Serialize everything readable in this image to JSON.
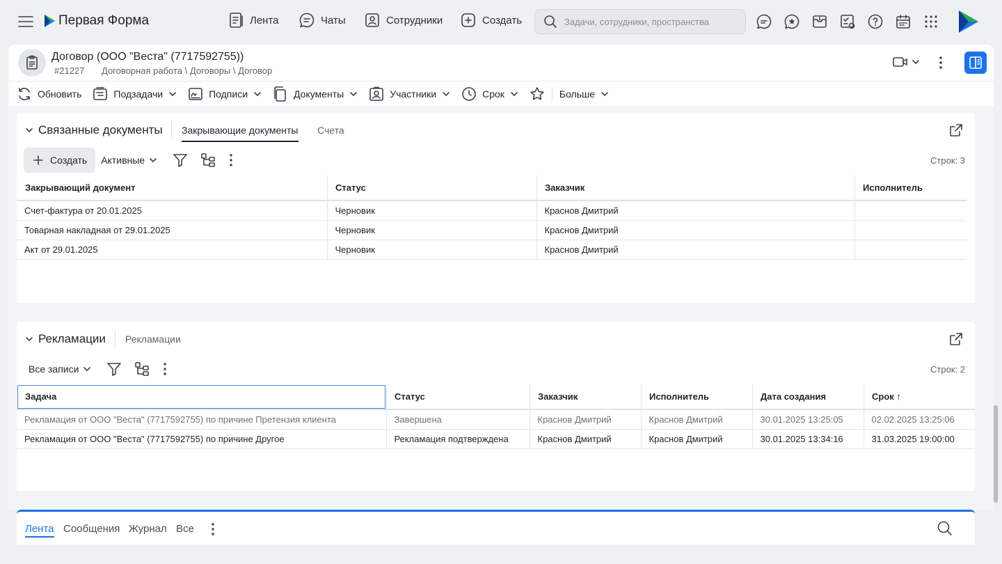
{
  "app": {
    "name": "Первая Форма",
    "nav": [
      {
        "label": "Лента",
        "icon": "feed-icon"
      },
      {
        "label": "Чаты",
        "icon": "chat-icon"
      },
      {
        "label": "Сотрудники",
        "icon": "employees-icon"
      },
      {
        "label": "Создать",
        "icon": "plus-square-icon"
      }
    ],
    "search_placeholder": "Задачи, сотрудники, пространства",
    "brand_color": "#1a73e8"
  },
  "document": {
    "title": "Договор (ООО \"Веста\" (7717592755))",
    "id": "#21227",
    "path": "Договорная работа \\ Договоры \\ Договор"
  },
  "toolbar": [
    {
      "label": "Обновить",
      "icon": "refresh-icon",
      "dropdown": false
    },
    {
      "label": "Подзадачи",
      "icon": "subtasks-icon",
      "dropdown": true
    },
    {
      "label": "Подписи",
      "icon": "signature-icon",
      "dropdown": true
    },
    {
      "label": "Документы",
      "icon": "documents-icon",
      "dropdown": true
    },
    {
      "label": "Участники",
      "icon": "participants-icon",
      "dropdown": true
    },
    {
      "label": "Срок",
      "icon": "clock-icon",
      "dropdown": true
    },
    {
      "label": "",
      "icon": "star-icon",
      "dropdown": false
    },
    {
      "label": "Больше",
      "icon": "",
      "dropdown": true
    }
  ],
  "related_docs": {
    "title": "Связанные документы",
    "tabs": [
      "Закрывающие документы",
      "Счета"
    ],
    "create_label": "Создать",
    "filter_label": "Активные",
    "row_count": "Строк: 3",
    "columns": [
      "Закрывающий документ",
      "Статус",
      "Заказчик",
      "Исполнитель"
    ],
    "rows": [
      [
        "Счет-фактура от 20.01.2025",
        "Черновик",
        "Краснов Дмитрий",
        ""
      ],
      [
        "Товарная накладная от 29.01.2025",
        "Черновик",
        "Краснов Дмитрий",
        ""
      ],
      [
        "Акт от 29.01.2025",
        "Черновик",
        "Краснов Дмитрий",
        ""
      ]
    ]
  },
  "claims": {
    "title": "Рекламации",
    "tabs": [
      "Рекламации"
    ],
    "filter_label": "Все записи",
    "row_count": "Строк: 2",
    "columns": [
      "Задача",
      "Статус",
      "Заказчик",
      "Исполнитель",
      "Дата создания",
      "Срок ↑"
    ],
    "rows": [
      [
        "Рекламация от ООО \"Веста\" (7717592755) по причине Претензия клиента",
        "Завершена",
        "Краснов Дмитрий",
        "Краснов Дмитрий",
        "30.01.2025 13:25:05",
        "02.02.2025 13:25:06"
      ],
      [
        "Рекламация от ООО \"Веста\" (7717592755) по причине Другое",
        "Рекламация подтверждена",
        "Краснов Дмитрий",
        "Краснов Дмитрий",
        "30.01.2025 13:34:16",
        "31.03.2025 19:00:00"
      ]
    ]
  },
  "feed": {
    "tabs": [
      "Лента",
      "Сообщения",
      "Журнал",
      "Все"
    ]
  }
}
